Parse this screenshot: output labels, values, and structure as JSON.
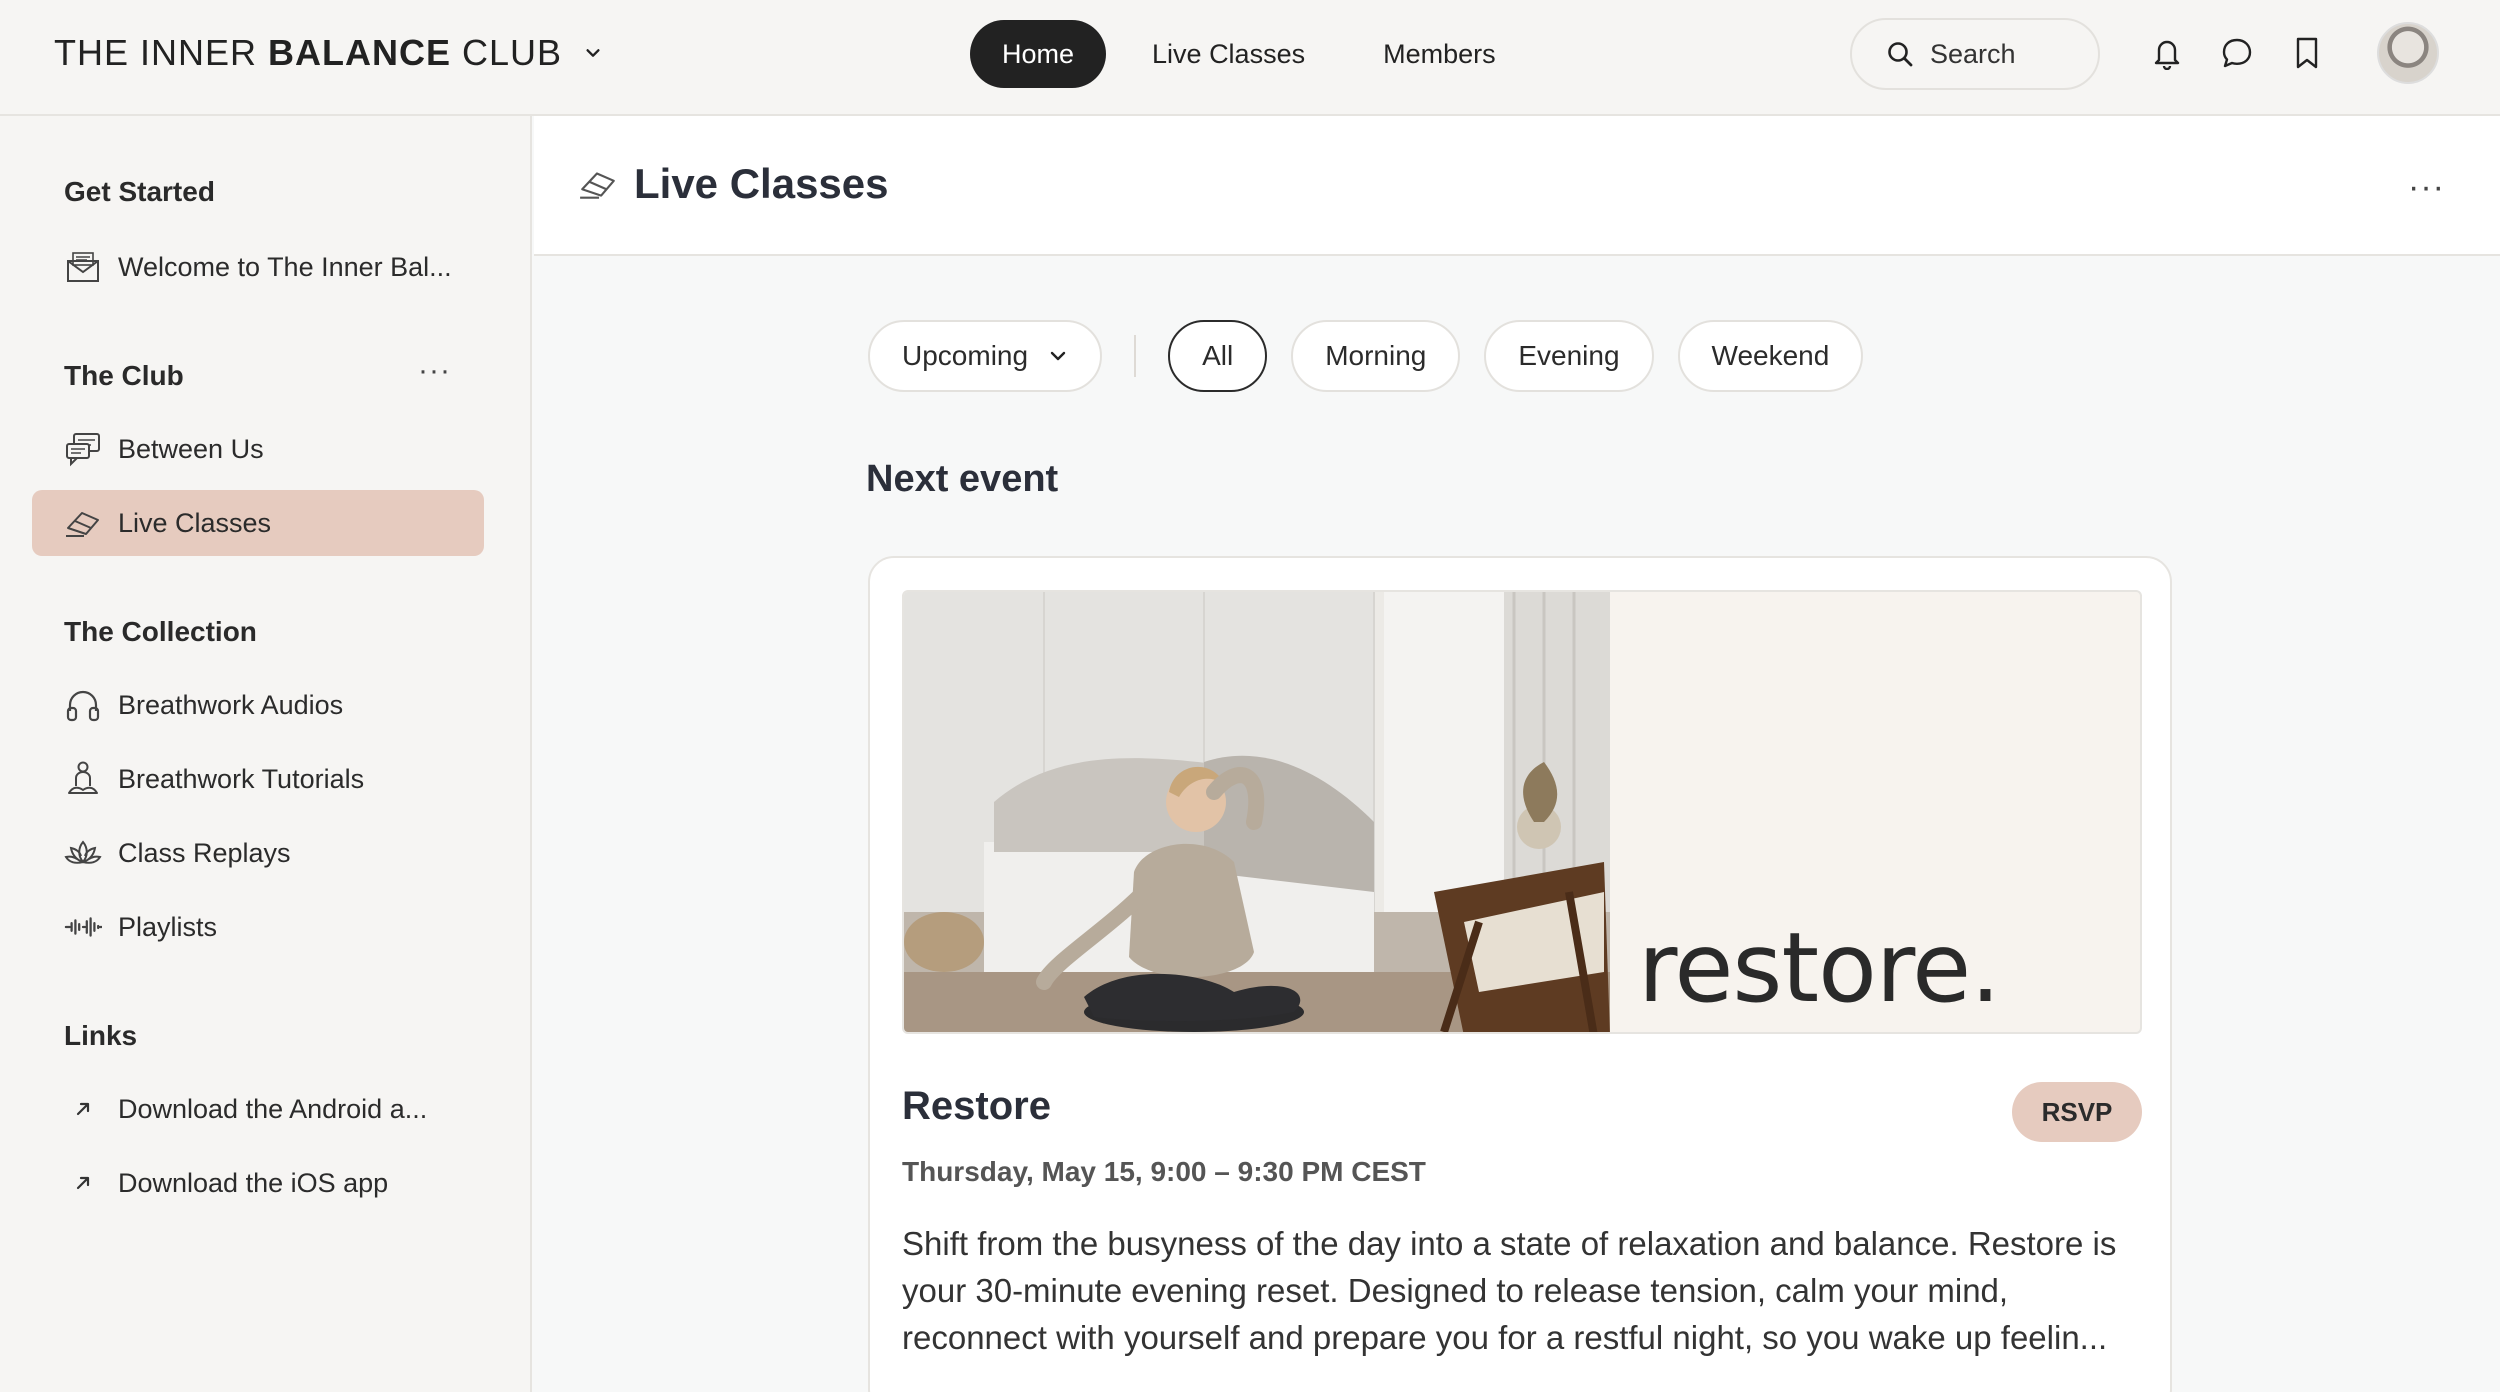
{
  "header": {
    "brand_prefix": "THE INNER ",
    "brand_bold": "BALANCE",
    "brand_suffix": " CLUB",
    "nav": [
      "Home",
      "Live Classes",
      "Members"
    ],
    "active_nav": "Home",
    "search_label": "Search"
  },
  "sidebar": {
    "sections": [
      {
        "title": "Get Started",
        "items": [
          {
            "label": "Welcome to The Inner Bal...",
            "icon": "envelope-icon"
          }
        ]
      },
      {
        "title": "The Club",
        "more": "···",
        "items": [
          {
            "label": "Between Us",
            "icon": "chat-bubbles-icon"
          },
          {
            "label": "Live Classes",
            "icon": "eraser-icon",
            "active": true
          }
        ]
      },
      {
        "title": "The Collection",
        "items": [
          {
            "label": "Breathwork Audios",
            "icon": "headphones-icon"
          },
          {
            "label": "Breathwork Tutorials",
            "icon": "meditation-icon"
          },
          {
            "label": "Class Replays",
            "icon": "lotus-icon"
          },
          {
            "label": "Playlists",
            "icon": "soundwave-icon"
          }
        ]
      },
      {
        "title": "Links",
        "items": [
          {
            "label": "Download the Android a...",
            "icon": "external-arrow-icon"
          },
          {
            "label": "Download the iOS app",
            "icon": "external-arrow-icon"
          }
        ]
      }
    ]
  },
  "page": {
    "title": "Live Classes",
    "more": "···"
  },
  "filters": {
    "dropdown": "Upcoming",
    "pills": [
      "All",
      "Morning",
      "Evening",
      "Weekend"
    ],
    "active": "All"
  },
  "event_section": {
    "title": "Next event",
    "event": {
      "banner_word": "restore.",
      "title": "Restore",
      "rsvp": "RSVP",
      "date": "Thursday, May 15, 9:00 – 9:30 PM CEST",
      "description": "Shift from the busyness of the day into a state of relaxation and balance. Restore is your 30-minute evening reset. Designed to release tension, calm your mind, reconnect with yourself and prepare you for a restful night, so you wake up feelin..."
    }
  },
  "colors": {
    "accent": "#e6cbbf",
    "nav_active_bg": "#222222",
    "sidebar_bg": "#f6f5f3"
  }
}
